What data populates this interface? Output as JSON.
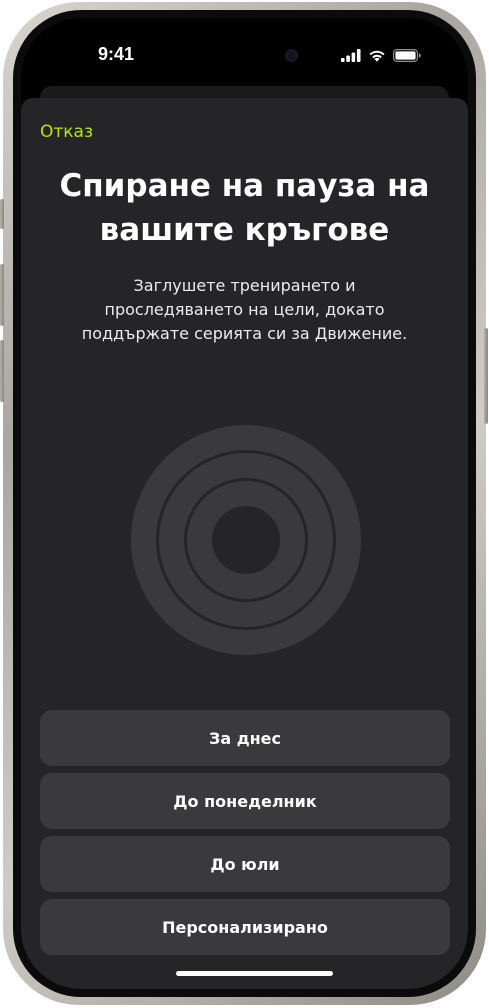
{
  "status_bar": {
    "time": "9:41",
    "icons": [
      "cellular-signal-icon",
      "wifi-icon",
      "battery-icon"
    ]
  },
  "sheet": {
    "cancel_label": "Отказ",
    "title": "Спиране на пауза на\nвашите кръгове",
    "subtitle": "Заглушете тренирането и\nпроследяването на цели, докато\nподдържате серията си за Движение.",
    "rings_icon": "activity-rings-icon",
    "options": [
      {
        "label": "За днес"
      },
      {
        "label": "До понеделник"
      },
      {
        "label": "До юли"
      },
      {
        "label": "Персонализирано"
      }
    ]
  },
  "colors": {
    "accent": "#b8e600",
    "sheet_background": "#252527",
    "button_background": "#3a3a3c",
    "rings": "#3a3a3c"
  }
}
